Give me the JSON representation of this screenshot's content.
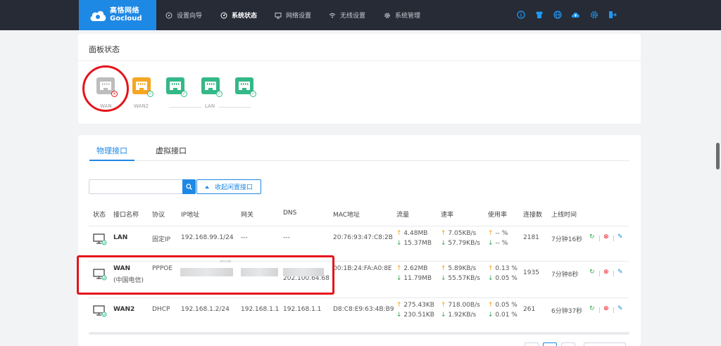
{
  "brand": {
    "name_cn": "高恪网络",
    "name_en": "Gocloud"
  },
  "nav": [
    {
      "label": "设置向导",
      "icon": "compass-icon"
    },
    {
      "label": "系统状态",
      "icon": "dashboard-icon",
      "active": true
    },
    {
      "label": "网络设置",
      "icon": "monitor-icon"
    },
    {
      "label": "无线设置",
      "icon": "wifi-icon"
    },
    {
      "label": "系统管理",
      "icon": "gear-icon"
    }
  ],
  "header_icons": [
    "info-icon",
    "shirt-icon",
    "globe-icon",
    "cloud-upload-icon",
    "settings-icon",
    "logout-icon"
  ],
  "panel": {
    "title": "面板状态",
    "ports": [
      {
        "label": "WAN",
        "status": "error",
        "color": "#bdbdbd"
      },
      {
        "label": "WAN2",
        "status": "ok",
        "color": "#f5a623"
      },
      {
        "label": "",
        "status": "ok",
        "color": "#34b887"
      },
      {
        "label": "",
        "status": "ok",
        "color": "#34b887"
      },
      {
        "label": "",
        "status": "ok",
        "color": "#34b887"
      }
    ],
    "lan_group_label": "LAN"
  },
  "tabs": [
    {
      "label": "物理接口",
      "active": true
    },
    {
      "label": "虚拟接口",
      "active": false
    }
  ],
  "search": {
    "placeholder": ""
  },
  "collapse_label": "收起闲置接口",
  "table": {
    "headers": [
      "状态",
      "接口名称",
      "协议",
      "IP地址",
      "网关",
      "DNS",
      "MAC地址",
      "流量",
      "速率",
      "使用率",
      "连接数",
      "上线时间"
    ],
    "rows": [
      {
        "name": "LAN",
        "sub": "",
        "protocol": "固定IP",
        "ip": "192.168.99.1/24",
        "gateway": "---",
        "dns": "---",
        "mac": "20:76:93:47:C8:2B",
        "traffic_up": "4.48MB",
        "traffic_down": "15.37MB",
        "rate_up": "7.05KB/s",
        "rate_down": "57.79KB/s",
        "usage_up": "-- %",
        "usage_down": "-- %",
        "conns": "2181",
        "uptime": "7分钟16秒"
      },
      {
        "name": "WAN",
        "sub": "(中国电信)",
        "protocol": "PPPOE",
        "ip": "",
        "gateway": "",
        "dns": "202.100.64.68",
        "mac": "00:1B:24:FA:A0:8E",
        "traffic_up": "2.62MB",
        "traffic_down": "11.79MB",
        "rate_up": "5.89KB/s",
        "rate_down": "55.57KB/s",
        "usage_up": "0.13 %",
        "usage_down": "0.05 %",
        "conns": "1935",
        "uptime": "7分钟8秒"
      },
      {
        "name": "WAN2",
        "sub": "",
        "protocol": "DHCP",
        "ip": "192.168.1.2/24",
        "gateway": "192.168.1.1",
        "dns": "192.168.1.1",
        "mac": "D8:C8:E9:63:4B:B9",
        "traffic_up": "275.43KB",
        "traffic_down": "230.51KB",
        "rate_up": "718.00B/s",
        "rate_down": "1.92KB/s",
        "usage_up": "0.05 %",
        "usage_down": "0.01 %",
        "conns": "261",
        "uptime": "6分钟37秒"
      }
    ]
  },
  "colors": {
    "accent": "#1e88e5",
    "topbar": "#262b35",
    "annotation": "#e5141a"
  }
}
